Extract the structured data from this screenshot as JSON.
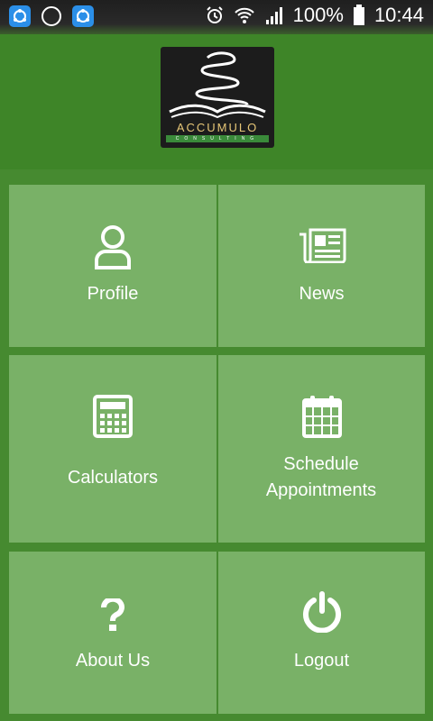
{
  "status_bar": {
    "battery": "100%",
    "time": "10:44"
  },
  "header": {
    "logo_text": "ACCUMULO",
    "logo_subtext": "CONSULTING"
  },
  "tiles": [
    {
      "label": "Profile",
      "icon": "person-icon"
    },
    {
      "label": "News",
      "icon": "newspaper-icon"
    },
    {
      "label": "Calculators",
      "icon": "calculator-icon"
    },
    {
      "label": "Schedule Appointments",
      "icon": "calendar-icon"
    },
    {
      "label": "About Us",
      "icon": "question-icon"
    },
    {
      "label": "Logout",
      "icon": "power-icon"
    }
  ],
  "colors": {
    "background": "#468a30",
    "tile": "#79b167",
    "text": "#ffffff"
  }
}
